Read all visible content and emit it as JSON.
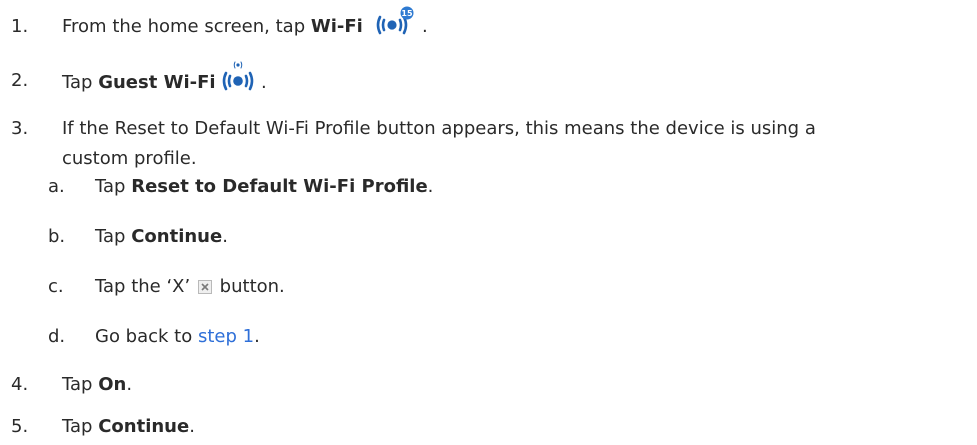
{
  "steps": [
    {
      "num": "1.",
      "pre": "From the home screen, tap ",
      "bold": "Wi-Fi",
      "post": " .",
      "icon": "wifi-badge-icon",
      "badge": "15"
    },
    {
      "num": "2.",
      "pre": "Tap ",
      "bold": "Guest Wi-Fi",
      "post": " .",
      "icon": "guest-wifi-icon"
    },
    {
      "num": "3.",
      "line1": "If the Reset to Default Wi-Fi Profile button appears, this means the device is using a",
      "line2": "custom profile."
    },
    {
      "num": "4.",
      "pre": "Tap ",
      "bold": "On",
      "post": "."
    },
    {
      "num": "5.",
      "pre": "Tap ",
      "bold": "Continue",
      "post": "."
    }
  ],
  "substeps": [
    {
      "letter": "a.",
      "pre": "Tap ",
      "bold": "Reset to Default Wi-Fi Profile",
      "post": "."
    },
    {
      "letter": "b.",
      "pre": "Tap ",
      "bold": "Continue",
      "post": "."
    },
    {
      "letter": "c.",
      "pre": "Tap the ‘X’ ",
      "post": " button.",
      "icon": "close-x-icon"
    },
    {
      "letter": "d.",
      "pre": "Go back to ",
      "link": "step 1",
      "post": "."
    }
  ],
  "colors": {
    "text": "#2a2a2a",
    "link": "#2e6fd8",
    "wifi": "#1f63b5"
  }
}
